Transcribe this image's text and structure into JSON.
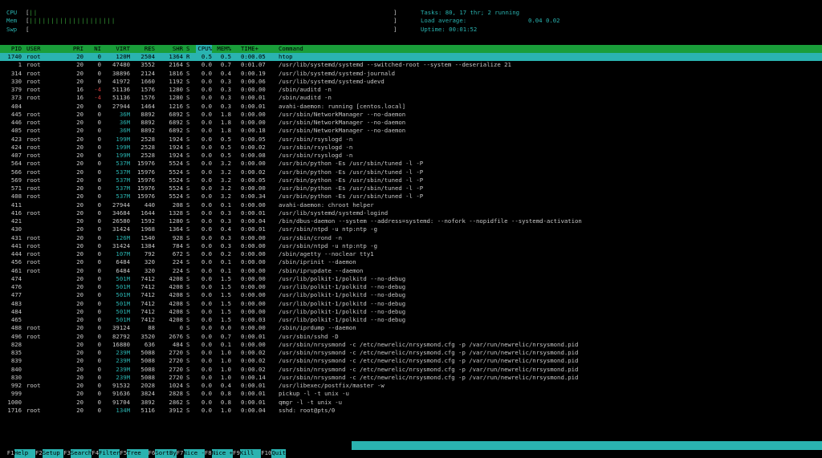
{
  "meters": [
    {
      "label": "CPU",
      "bars": "||",
      "end": "]"
    },
    {
      "label": "Mem",
      "bars": "||||||||||||||||||||",
      "end": "]"
    },
    {
      "label": "Swp",
      "bars": "",
      "end": "]"
    }
  ],
  "sysinfo": {
    "tasks_label": "Tasks:",
    "tasks_value": "80, 17 thr; 2 running",
    "load_label": "Load average:",
    "load_1": "0.04",
    "load_2": "0.02",
    "uptime_label": "Uptime:",
    "uptime_value": "00:01:52"
  },
  "columns": {
    "pid": "PID",
    "user": "USER",
    "pri": "PRI",
    "ni": "NI",
    "virt": "VIRT",
    "res": "RES",
    "shr": "SHR",
    "s": "S",
    "cpu": "CPU%",
    "mem": "MEM%",
    "time": "TIME+",
    "cmd": "Command"
  },
  "processes": [
    {
      "pid": "1740",
      "user": "root",
      "pri": "20",
      "ni": "0",
      "virt": "120M",
      "res": "2504",
      "shr": "1364",
      "s": "R",
      "cpu": "0.5",
      "mem": "0.5",
      "time": "0:00.05",
      "cmd": "htop",
      "sel": true
    },
    {
      "pid": "1",
      "user": "root",
      "pri": "20",
      "ni": "0",
      "virt": "47480",
      "res": "3552",
      "shr": "2164",
      "s": "S",
      "cpu": "0.0",
      "mem": "0.7",
      "time": "0:01.07",
      "cmd": "/usr/lib/systemd/systemd --switched-root --system --deserialize 21"
    },
    {
      "pid": "314",
      "user": "root",
      "pri": "20",
      "ni": "0",
      "virt": "38896",
      "res": "2124",
      "shr": "1816",
      "s": "S",
      "cpu": "0.0",
      "mem": "0.4",
      "time": "0:00.19",
      "cmd": "/usr/lib/systemd/systemd-journald"
    },
    {
      "pid": "330",
      "user": "root",
      "pri": "20",
      "ni": "0",
      "virt": "41972",
      "res": "1660",
      "shr": "1192",
      "s": "S",
      "cpu": "0.0",
      "mem": "0.3",
      "time": "0:00.06",
      "cmd": "/usr/lib/systemd/systemd-udevd"
    },
    {
      "pid": "379",
      "user": "root",
      "pri": "16",
      "ni": "-4",
      "virt": "51136",
      "res": "1576",
      "shr": "1280",
      "s": "S",
      "cpu": "0.0",
      "mem": "0.3",
      "time": "0:00.00",
      "cmd": "/sbin/auditd -n"
    },
    {
      "pid": "373",
      "user": "root",
      "pri": "16",
      "ni": "-4",
      "virt": "51136",
      "res": "1576",
      "shr": "1280",
      "s": "S",
      "cpu": "0.0",
      "mem": "0.3",
      "time": "0:00.01",
      "cmd": "/sbin/auditd -n"
    },
    {
      "pid": "404",
      "user": "",
      "pri": "20",
      "ni": "0",
      "virt": "27944",
      "res": "1464",
      "shr": "1216",
      "s": "S",
      "cpu": "0.0",
      "mem": "0.3",
      "time": "0:00.01",
      "cmd": "avahi-daemon: running [centos.local]"
    },
    {
      "pid": "445",
      "user": "root",
      "pri": "20",
      "ni": "0",
      "virt": "36M",
      "res": "8892",
      "shr": "6892",
      "s": "S",
      "cpu": "0.0",
      "mem": "1.8",
      "time": "0:00.00",
      "cmd": "/usr/sbin/NetworkManager --no-daemon"
    },
    {
      "pid": "446",
      "user": "root",
      "pri": "20",
      "ni": "0",
      "virt": "36M",
      "res": "8892",
      "shr": "6892",
      "s": "S",
      "cpu": "0.0",
      "mem": "1.8",
      "time": "0:00.00",
      "cmd": "/usr/sbin/NetworkManager --no-daemon"
    },
    {
      "pid": "405",
      "user": "root",
      "pri": "20",
      "ni": "0",
      "virt": "36M",
      "res": "8892",
      "shr": "6892",
      "s": "S",
      "cpu": "0.0",
      "mem": "1.8",
      "time": "0:00.18",
      "cmd": "/usr/sbin/NetworkManager --no-daemon"
    },
    {
      "pid": "423",
      "user": "root",
      "pri": "20",
      "ni": "0",
      "virt": "199M",
      "res": "2528",
      "shr": "1924",
      "s": "S",
      "cpu": "0.0",
      "mem": "0.5",
      "time": "0:00.05",
      "cmd": "/usr/sbin/rsyslogd -n"
    },
    {
      "pid": "424",
      "user": "root",
      "pri": "20",
      "ni": "0",
      "virt": "199M",
      "res": "2528",
      "shr": "1924",
      "s": "S",
      "cpu": "0.0",
      "mem": "0.5",
      "time": "0:00.02",
      "cmd": "/usr/sbin/rsyslogd -n"
    },
    {
      "pid": "407",
      "user": "root",
      "pri": "20",
      "ni": "0",
      "virt": "199M",
      "res": "2528",
      "shr": "1924",
      "s": "S",
      "cpu": "0.0",
      "mem": "0.5",
      "time": "0:00.08",
      "cmd": "/usr/sbin/rsyslogd -n"
    },
    {
      "pid": "564",
      "user": "root",
      "pri": "20",
      "ni": "0",
      "virt": "537M",
      "res": "15976",
      "shr": "5524",
      "s": "S",
      "cpu": "0.0",
      "mem": "3.2",
      "time": "0:00.00",
      "cmd": "/usr/bin/python -Es /usr/sbin/tuned -l -P"
    },
    {
      "pid": "566",
      "user": "root",
      "pri": "20",
      "ni": "0",
      "virt": "537M",
      "res": "15976",
      "shr": "5524",
      "s": "S",
      "cpu": "0.0",
      "mem": "3.2",
      "time": "0:00.02",
      "cmd": "/usr/bin/python -Es /usr/sbin/tuned -l -P"
    },
    {
      "pid": "569",
      "user": "root",
      "pri": "20",
      "ni": "0",
      "virt": "537M",
      "res": "15976",
      "shr": "5524",
      "s": "S",
      "cpu": "0.0",
      "mem": "3.2",
      "time": "0:00.05",
      "cmd": "/usr/bin/python -Es /usr/sbin/tuned -l -P"
    },
    {
      "pid": "571",
      "user": "root",
      "pri": "20",
      "ni": "0",
      "virt": "537M",
      "res": "15976",
      "shr": "5524",
      "s": "S",
      "cpu": "0.0",
      "mem": "3.2",
      "time": "0:00.00",
      "cmd": "/usr/bin/python -Es /usr/sbin/tuned -l -P"
    },
    {
      "pid": "408",
      "user": "root",
      "pri": "20",
      "ni": "0",
      "virt": "537M",
      "res": "15976",
      "shr": "5524",
      "s": "S",
      "cpu": "0.0",
      "mem": "3.2",
      "time": "0:00.34",
      "cmd": "/usr/bin/python -Es /usr/sbin/tuned -l -P"
    },
    {
      "pid": "411",
      "user": "",
      "pri": "20",
      "ni": "0",
      "virt": "27944",
      "res": "440",
      "shr": "208",
      "s": "S",
      "cpu": "0.0",
      "mem": "0.1",
      "time": "0:00.00",
      "cmd": "avahi-daemon: chroot helper"
    },
    {
      "pid": "416",
      "user": "root",
      "pri": "20",
      "ni": "0",
      "virt": "34684",
      "res": "1644",
      "shr": "1328",
      "s": "S",
      "cpu": "0.0",
      "mem": "0.3",
      "time": "0:00.01",
      "cmd": "/usr/lib/systemd/systemd-logind"
    },
    {
      "pid": "421",
      "user": "",
      "pri": "20",
      "ni": "0",
      "virt": "26580",
      "res": "1592",
      "shr": "1280",
      "s": "S",
      "cpu": "0.0",
      "mem": "0.3",
      "time": "0:00.04",
      "cmd": "/bin/dbus-daemon --system --address=systemd: --nofork --nopidfile --systemd-activation"
    },
    {
      "pid": "430",
      "user": "",
      "pri": "20",
      "ni": "0",
      "virt": "31424",
      "res": "1968",
      "shr": "1364",
      "s": "S",
      "cpu": "0.0",
      "mem": "0.4",
      "time": "0:00.01",
      "cmd": "/usr/sbin/ntpd -u ntp:ntp -g"
    },
    {
      "pid": "431",
      "user": "root",
      "pri": "20",
      "ni": "0",
      "virt": "126M",
      "res": "1540",
      "shr": "928",
      "s": "S",
      "cpu": "0.0",
      "mem": "0.3",
      "time": "0:00.00",
      "cmd": "/usr/sbin/crond -n"
    },
    {
      "pid": "441",
      "user": "root",
      "pri": "20",
      "ni": "0",
      "virt": "31424",
      "res": "1384",
      "shr": "784",
      "s": "S",
      "cpu": "0.0",
      "mem": "0.3",
      "time": "0:00.00",
      "cmd": "/usr/sbin/ntpd -u ntp:ntp -g"
    },
    {
      "pid": "444",
      "user": "root",
      "pri": "20",
      "ni": "0",
      "virt": "107M",
      "res": "792",
      "shr": "672",
      "s": "S",
      "cpu": "0.0",
      "mem": "0.2",
      "time": "0:00.00",
      "cmd": "/sbin/agetty --noclear tty1"
    },
    {
      "pid": "456",
      "user": "root",
      "pri": "20",
      "ni": "0",
      "virt": "6484",
      "res": "320",
      "shr": "224",
      "s": "S",
      "cpu": "0.0",
      "mem": "0.1",
      "time": "0:00.00",
      "cmd": "/sbin/iprinit --daemon"
    },
    {
      "pid": "461",
      "user": "root",
      "pri": "20",
      "ni": "0",
      "virt": "6484",
      "res": "320",
      "shr": "224",
      "s": "S",
      "cpu": "0.0",
      "mem": "0.1",
      "time": "0:00.00",
      "cmd": "/sbin/iprupdate --daemon"
    },
    {
      "pid": "474",
      "user": "",
      "pri": "20",
      "ni": "0",
      "virt": "501M",
      "res": "7412",
      "shr": "4208",
      "s": "S",
      "cpu": "0.0",
      "mem": "1.5",
      "time": "0:00.00",
      "cmd": "/usr/lib/polkit-1/polkitd --no-debug"
    },
    {
      "pid": "476",
      "user": "",
      "pri": "20",
      "ni": "0",
      "virt": "501M",
      "res": "7412",
      "shr": "4208",
      "s": "S",
      "cpu": "0.0",
      "mem": "1.5",
      "time": "0:00.00",
      "cmd": "/usr/lib/polkit-1/polkitd --no-debug"
    },
    {
      "pid": "477",
      "user": "",
      "pri": "20",
      "ni": "0",
      "virt": "501M",
      "res": "7412",
      "shr": "4208",
      "s": "S",
      "cpu": "0.0",
      "mem": "1.5",
      "time": "0:00.00",
      "cmd": "/usr/lib/polkit-1/polkitd --no-debug"
    },
    {
      "pid": "483",
      "user": "",
      "pri": "20",
      "ni": "0",
      "virt": "501M",
      "res": "7412",
      "shr": "4208",
      "s": "S",
      "cpu": "0.0",
      "mem": "1.5",
      "time": "0:00.00",
      "cmd": "/usr/lib/polkit-1/polkitd --no-debug"
    },
    {
      "pid": "484",
      "user": "",
      "pri": "20",
      "ni": "0",
      "virt": "501M",
      "res": "7412",
      "shr": "4208",
      "s": "S",
      "cpu": "0.0",
      "mem": "1.5",
      "time": "0:00.00",
      "cmd": "/usr/lib/polkit-1/polkitd --no-debug"
    },
    {
      "pid": "465",
      "user": "",
      "pri": "20",
      "ni": "0",
      "virt": "501M",
      "res": "7412",
      "shr": "4208",
      "s": "S",
      "cpu": "0.0",
      "mem": "1.5",
      "time": "0:00.03",
      "cmd": "/usr/lib/polkit-1/polkitd --no-debug"
    },
    {
      "pid": "488",
      "user": "root",
      "pri": "20",
      "ni": "0",
      "virt": "39124",
      "res": "88",
      "shr": "0",
      "s": "S",
      "cpu": "0.0",
      "mem": "0.0",
      "time": "0:00.00",
      "cmd": "/sbin/iprdump --daemon"
    },
    {
      "pid": "496",
      "user": "root",
      "pri": "20",
      "ni": "0",
      "virt": "82792",
      "res": "3520",
      "shr": "2676",
      "s": "S",
      "cpu": "0.0",
      "mem": "0.7",
      "time": "0:00.01",
      "cmd": "/usr/sbin/sshd -D"
    },
    {
      "pid": "828",
      "user": "",
      "pri": "20",
      "ni": "0",
      "virt": "16880",
      "res": "636",
      "shr": "484",
      "s": "S",
      "cpu": "0.0",
      "mem": "0.1",
      "time": "0:00.00",
      "cmd": "/usr/sbin/nrsysmond -c /etc/newrelic/nrsysmond.cfg -p /var/run/newrelic/nrsysmond.pid"
    },
    {
      "pid": "835",
      "user": "",
      "pri": "20",
      "ni": "0",
      "virt": "239M",
      "res": "5088",
      "shr": "2720",
      "s": "S",
      "cpu": "0.0",
      "mem": "1.0",
      "time": "0:00.02",
      "cmd": "/usr/sbin/nrsysmond -c /etc/newrelic/nrsysmond.cfg -p /var/run/newrelic/nrsysmond.pid"
    },
    {
      "pid": "839",
      "user": "",
      "pri": "20",
      "ni": "0",
      "virt": "239M",
      "res": "5088",
      "shr": "2720",
      "s": "S",
      "cpu": "0.0",
      "mem": "1.0",
      "time": "0:00.02",
      "cmd": "/usr/sbin/nrsysmond -c /etc/newrelic/nrsysmond.cfg -p /var/run/newrelic/nrsysmond.pid"
    },
    {
      "pid": "840",
      "user": "",
      "pri": "20",
      "ni": "0",
      "virt": "239M",
      "res": "5088",
      "shr": "2720",
      "s": "S",
      "cpu": "0.0",
      "mem": "1.0",
      "time": "0:00.02",
      "cmd": "/usr/sbin/nrsysmond -c /etc/newrelic/nrsysmond.cfg -p /var/run/newrelic/nrsysmond.pid"
    },
    {
      "pid": "830",
      "user": "",
      "pri": "20",
      "ni": "0",
      "virt": "239M",
      "res": "5088",
      "shr": "2720",
      "s": "S",
      "cpu": "0.0",
      "mem": "1.0",
      "time": "0:00.14",
      "cmd": "/usr/sbin/nrsysmond -c /etc/newrelic/nrsysmond.cfg -p /var/run/newrelic/nrsysmond.pid"
    },
    {
      "pid": "992",
      "user": "root",
      "pri": "20",
      "ni": "0",
      "virt": "91532",
      "res": "2028",
      "shr": "1024",
      "s": "S",
      "cpu": "0.0",
      "mem": "0.4",
      "time": "0:00.01",
      "cmd": "/usr/libexec/postfix/master -w"
    },
    {
      "pid": "999",
      "user": "",
      "pri": "20",
      "ni": "0",
      "virt": "91636",
      "res": "3824",
      "shr": "2828",
      "s": "S",
      "cpu": "0.0",
      "mem": "0.8",
      "time": "0:00.01",
      "cmd": "pickup -l -t unix -u"
    },
    {
      "pid": "1000",
      "user": "",
      "pri": "20",
      "ni": "0",
      "virt": "91704",
      "res": "3892",
      "shr": "2862",
      "s": "S",
      "cpu": "0.0",
      "mem": "0.8",
      "time": "0:00.01",
      "cmd": "qmgr -l -t unix -u"
    },
    {
      "pid": "1716",
      "user": "root",
      "pri": "20",
      "ni": "0",
      "virt": "134M",
      "res": "5116",
      "shr": "3912",
      "s": "S",
      "cpu": "0.0",
      "mem": "1.0",
      "time": "0:00.04",
      "cmd": "sshd: root@pts/0"
    }
  ],
  "fkeys": [
    {
      "key": "F1",
      "label": "Help  "
    },
    {
      "key": "F2",
      "label": "Setup "
    },
    {
      "key": "F3",
      "label": "Search"
    },
    {
      "key": "F4",
      "label": "Filter"
    },
    {
      "key": "F5",
      "label": "Tree  "
    },
    {
      "key": "F6",
      "label": "SortBy"
    },
    {
      "key": "F7",
      "label": "Nice -"
    },
    {
      "key": "F8",
      "label": "Nice +"
    },
    {
      "key": "F9",
      "label": "Kill  "
    },
    {
      "key": "F10",
      "label": "Quit"
    }
  ],
  "colors": {
    "teal": "#2ab3b0",
    "green": "#3aa83a",
    "header_green": "#1a9e3a",
    "red": "#c83a3a"
  }
}
